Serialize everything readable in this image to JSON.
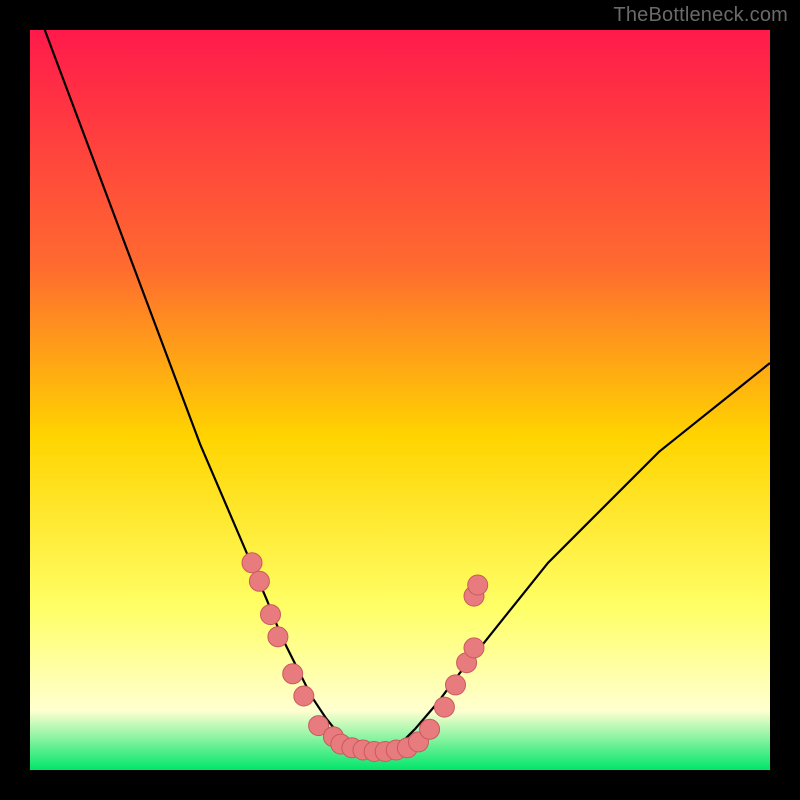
{
  "watermark": "TheBottleneck.com",
  "colors": {
    "frame": "#000000",
    "grad_top": "#ff1a4b",
    "grad_mid1": "#ff6b2f",
    "grad_mid2": "#ffd400",
    "grad_mid3": "#ffff66",
    "grad_low": "#ffffd0",
    "grad_bottom": "#00e66a",
    "curve": "#000000",
    "marker_fill": "#e77b7d",
    "marker_stroke": "#c95a5d"
  },
  "chart_data": {
    "type": "line",
    "title": "",
    "xlabel": "",
    "ylabel": "",
    "xlim": [
      0,
      100
    ],
    "ylim": [
      0,
      100
    ],
    "series": [
      {
        "name": "bottleneck-curve",
        "x": [
          2,
          5,
          8,
          11,
          14,
          17,
          20,
          23,
          26,
          29,
          32,
          34,
          36,
          38,
          40,
          42,
          44,
          46,
          48,
          50,
          52,
          55,
          58,
          62,
          66,
          70,
          75,
          80,
          85,
          90,
          95,
          100
        ],
        "y": [
          100,
          92,
          84,
          76,
          68,
          60,
          52,
          44,
          37,
          30,
          23,
          18,
          14,
          10,
          7,
          4.5,
          3,
          2.3,
          2.5,
          3.5,
          5.5,
          9,
          13,
          18,
          23,
          28,
          33,
          38,
          43,
          47,
          51,
          55
        ]
      }
    ],
    "markers": [
      {
        "x": 30.0,
        "y": 28.0
      },
      {
        "x": 31.0,
        "y": 25.5
      },
      {
        "x": 32.5,
        "y": 21.0
      },
      {
        "x": 33.5,
        "y": 18.0
      },
      {
        "x": 35.5,
        "y": 13.0
      },
      {
        "x": 37.0,
        "y": 10.0
      },
      {
        "x": 39.0,
        "y": 6.0
      },
      {
        "x": 41.0,
        "y": 4.5
      },
      {
        "x": 42.0,
        "y": 3.5
      },
      {
        "x": 43.5,
        "y": 3.0
      },
      {
        "x": 45.0,
        "y": 2.7
      },
      {
        "x": 46.5,
        "y": 2.5
      },
      {
        "x": 48.0,
        "y": 2.5
      },
      {
        "x": 49.5,
        "y": 2.7
      },
      {
        "x": 51.0,
        "y": 3.0
      },
      {
        "x": 52.5,
        "y": 3.8
      },
      {
        "x": 54.0,
        "y": 5.5
      },
      {
        "x": 56.0,
        "y": 8.5
      },
      {
        "x": 57.5,
        "y": 11.5
      },
      {
        "x": 59.0,
        "y": 14.5
      },
      {
        "x": 60.0,
        "y": 23.5
      },
      {
        "x": 60.5,
        "y": 25.0
      },
      {
        "x": 60.0,
        "y": 16.5
      }
    ]
  }
}
